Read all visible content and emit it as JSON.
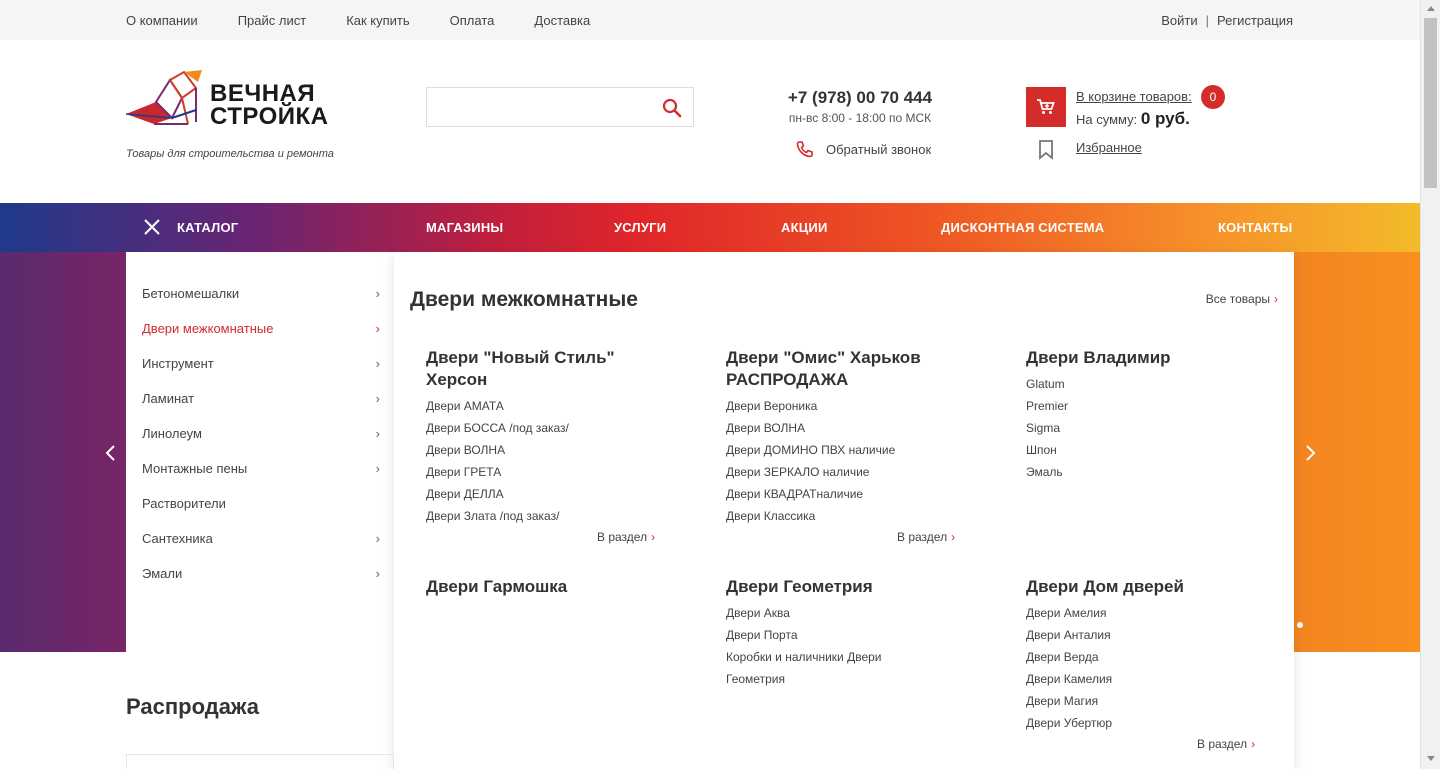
{
  "topbar": {
    "links": [
      "О компании",
      "Прайс лист",
      "Как купить",
      "Оплата",
      "Доставка"
    ],
    "login": "Войти",
    "register": "Регистрация"
  },
  "header": {
    "logo_line1": "ВЕЧНАЯ",
    "logo_line2": "СТРОЙКА",
    "tagline": "Товары для строительства и ремонта",
    "search_placeholder": "",
    "phone": "+7 (978) 00 70 444",
    "hours": "пн-вс 8:00 - 18:00 по МСК",
    "callback": "Обратный звонок",
    "cart_link": "В корзине товаров:",
    "cart_sum_label": "На сумму:",
    "cart_sum_value": "0 руб.",
    "cart_count": "0",
    "favorites": "Избранное"
  },
  "nav": {
    "catalog": "КАТАЛОГ",
    "items": [
      "МАГАЗИНЫ",
      "УСЛУГИ",
      "АКЦИИ",
      "ДИСКОНТНАЯ СИСТЕМА",
      "КОНТАКТЫ"
    ]
  },
  "catalog": {
    "items": [
      {
        "label": "Бетономешалки",
        "arrow": "›"
      },
      {
        "label": "Двери межкомнатные",
        "arrow": "›"
      },
      {
        "label": "Инструмент",
        "arrow": "›"
      },
      {
        "label": "Ламинат",
        "arrow": "›"
      },
      {
        "label": "Линолеум",
        "arrow": "›"
      },
      {
        "label": "Монтажные пены",
        "arrow": "›"
      },
      {
        "label": "Растворители",
        "arrow": ""
      },
      {
        "label": "Сантехника",
        "arrow": "›"
      },
      {
        "label": "Эмали",
        "arrow": "›"
      }
    ]
  },
  "panel": {
    "title": "Двери межкомнатные",
    "all_link": "Все товары",
    "section_link": "В раздел",
    "arrow": "›",
    "sections": [
      {
        "title": "Двери \"Новый Стиль\" Херсон",
        "links": [
          "Двери АМАТА",
          "Двери БОССА /под заказ/",
          "Двери ВОЛНА",
          "Двери ГРЕТА",
          "Двери ДЕЛЛА",
          "Двери Злата /под заказ/"
        ]
      },
      {
        "title": "Двери \"Омис\" Харьков РАСПРОДАЖА",
        "links": [
          "Двери Вероника",
          "Двери ВОЛНА",
          "Двери ДОМИНО ПВХ наличие",
          "Двери ЗЕРКАЛО наличие",
          "Двери КВАДРАТналичие",
          "Двери Классика"
        ]
      },
      {
        "title": "Двери Владимир",
        "links": [
          "Glatum",
          "Premier",
          "Sigma",
          "Шпон",
          "Эмаль"
        ]
      },
      {
        "title": "Двери Гармошка",
        "links": []
      },
      {
        "title": "Двери Геометрия",
        "links": [
          "Двери Аква",
          "Двери Порта",
          "Коробки и наличники Двери",
          "Геометрия"
        ]
      },
      {
        "title": "Двери Дом дверей",
        "links": [
          "Двери Амелия",
          "Двери Анталия",
          "Двери Верда",
          "Двери Камелия",
          "Двери Магия",
          "Двери Убертюр"
        ]
      }
    ]
  },
  "sale": {
    "title": "Распродажа"
  },
  "colors": {
    "accent": "#d42b2b"
  }
}
